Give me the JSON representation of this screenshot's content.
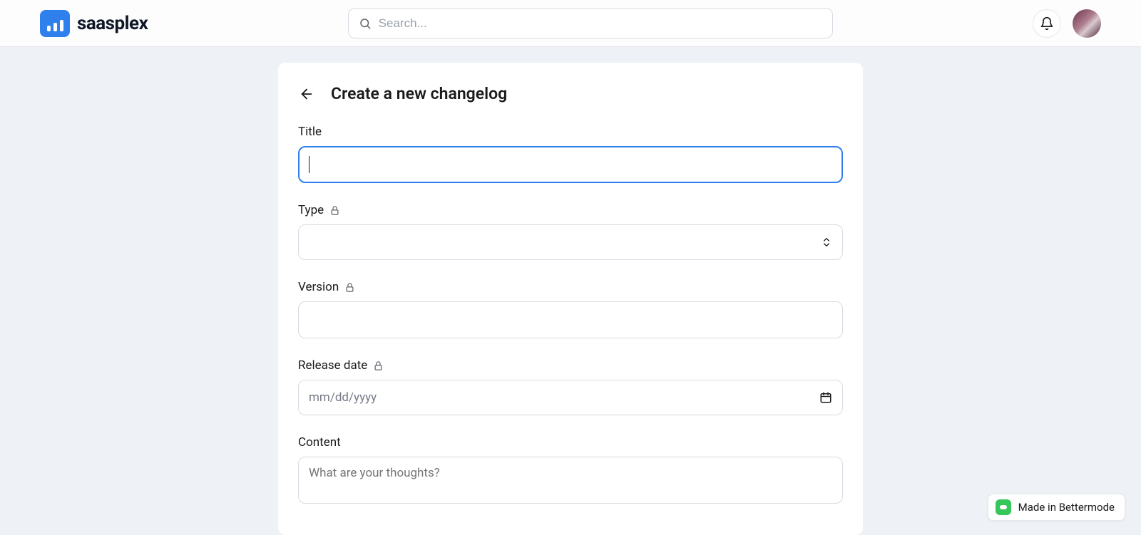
{
  "header": {
    "brand_name": "saasplex",
    "search_placeholder": "Search..."
  },
  "card": {
    "title": "Create a new changelog"
  },
  "form": {
    "title_label": "Title",
    "title_value": "",
    "type_label": "Type",
    "type_value": "",
    "version_label": "Version",
    "version_value": "",
    "release_date_label": "Release date",
    "release_date_placeholder": "mm/dd/yyyy",
    "content_label": "Content",
    "content_placeholder": "What are your thoughts?"
  },
  "badge": {
    "text": "Made in Bettermode"
  }
}
